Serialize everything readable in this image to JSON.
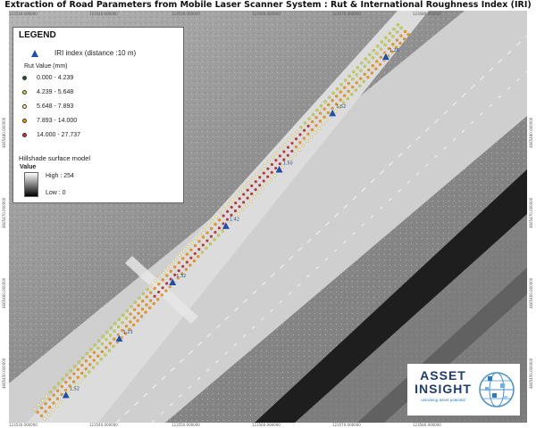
{
  "title": "Extraction of Road Parameters from Mobile Laser Scanner System : Rut & International Roughness Index (IRI)",
  "legend": {
    "title": "LEGEND",
    "iri_label": "IRI index (distance :10 m)",
    "rut_title": "Rut Value (mm)",
    "rut_classes": [
      {
        "label": "0.000 - 4.239",
        "color": "#1b5e20"
      },
      {
        "label": "4.239 - 5.648",
        "color": "#cddc39"
      },
      {
        "label": "5.648 - 7.893",
        "color": "#fff59d"
      },
      {
        "label": "7.893 - 14.000",
        "color": "#ff9800"
      },
      {
        "label": "14.000 - 27.737",
        "color": "#d32f2f"
      }
    ],
    "hillshade_title": "Hillshade surface model",
    "hillshade_value": "Value",
    "hillshade_high": "High : 254",
    "hillshade_low": "Low : 0"
  },
  "iri_values": [
    "1.52",
    "1.23",
    "1.32",
    "1.42",
    "1.50",
    "1.52",
    "1.26"
  ],
  "grid_labels": {
    "top": [
      "123530.000000",
      "123540.000000",
      "123550.000000",
      "123560.000000",
      "123570.000000",
      "123580.000000"
    ],
    "bottom": [
      "123530.000000",
      "123540.000000",
      "123550.000000",
      "123560.000000",
      "123570.000000",
      "123580.000000"
    ],
    "left": [
      "4665480.000000",
      "4665470.000000",
      "4665460.000000",
      "4665450.000000",
      "4665440.000000"
    ],
    "right": [
      "4665480.000000",
      "4665470.000000",
      "4665460.000000",
      "4665450.000000",
      "4665440.000000"
    ]
  },
  "logo": {
    "line1": "ASSET",
    "line2": "INSIGHT",
    "tagline": "unlocking asset potential"
  },
  "colors": {
    "road_surface": "#d0d0d0",
    "terrain": "#8f8f8f",
    "dark_strip": "#1e1e1e",
    "iri_marker": "#1f4fa8",
    "logo_text": "#1e3c6e"
  }
}
